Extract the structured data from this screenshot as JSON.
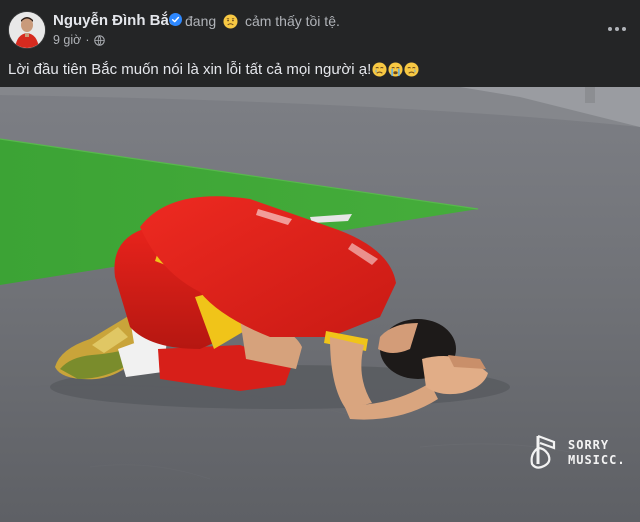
{
  "post": {
    "author": "Nguyễn Đình Bắc",
    "feeling_prefix": "đang",
    "feeling_text": "cảm thấy tồi tệ.",
    "time": "9 giờ",
    "separator": "·",
    "caption": "Lời đầu tiên Bắc muốn nói là xin lỗi tất cả mọi người ạ!",
    "caption_emojis": [
      "crying-face-emoji",
      "crying-face-emoji",
      "crying-face-emoji"
    ],
    "feeling_emoji": "sad-face-emoji",
    "privacy_icon": "globe-icon",
    "verified_icon": "verified-badge-icon"
  },
  "watermark": {
    "line1": "SORRY",
    "line2": "MUSICC."
  },
  "colors": {
    "background": "#242526",
    "text_primary": "#e4e6eb",
    "text_secondary": "#b0b3b8",
    "verified_blue": "#2d88ff",
    "jersey_red": "#e3201b",
    "turf_green": "#3fa636"
  }
}
